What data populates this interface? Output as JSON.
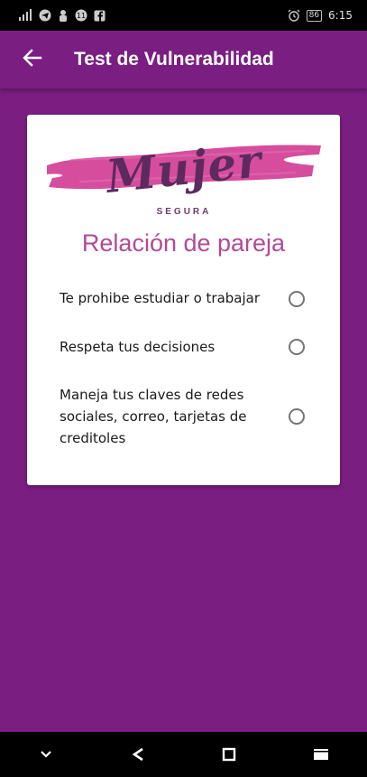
{
  "status_bar": {
    "time": "6:15",
    "battery_level": "86",
    "icons": [
      "signal-icon",
      "telegram-icon",
      "person-icon",
      "notification-badge-icon",
      "facebook-icon",
      "alarm-icon",
      "battery-icon"
    ]
  },
  "app_bar": {
    "title": "Test de Vulnerabilidad",
    "back_icon": "arrow-back-icon"
  },
  "logo": {
    "script_text": "Mujer",
    "subtitle": "SEGURA",
    "brush_color": "#d64d9e"
  },
  "section": {
    "title": "Relación de pareja"
  },
  "questions": [
    {
      "text": "Te prohibe estudiar o trabajar",
      "selected": false
    },
    {
      "text": "Respeta tus decisiones",
      "selected": false
    },
    {
      "text": "Maneja tus claves de redes sociales, correo, tarjetas de creditoles",
      "selected": false
    }
  ],
  "nav_bar": {
    "buttons": [
      "chevron-down-icon",
      "back-nav-icon",
      "home-square-icon",
      "recents-icon"
    ]
  },
  "colors": {
    "primary": "#7a1e82",
    "title_pink": "#b24a96"
  }
}
